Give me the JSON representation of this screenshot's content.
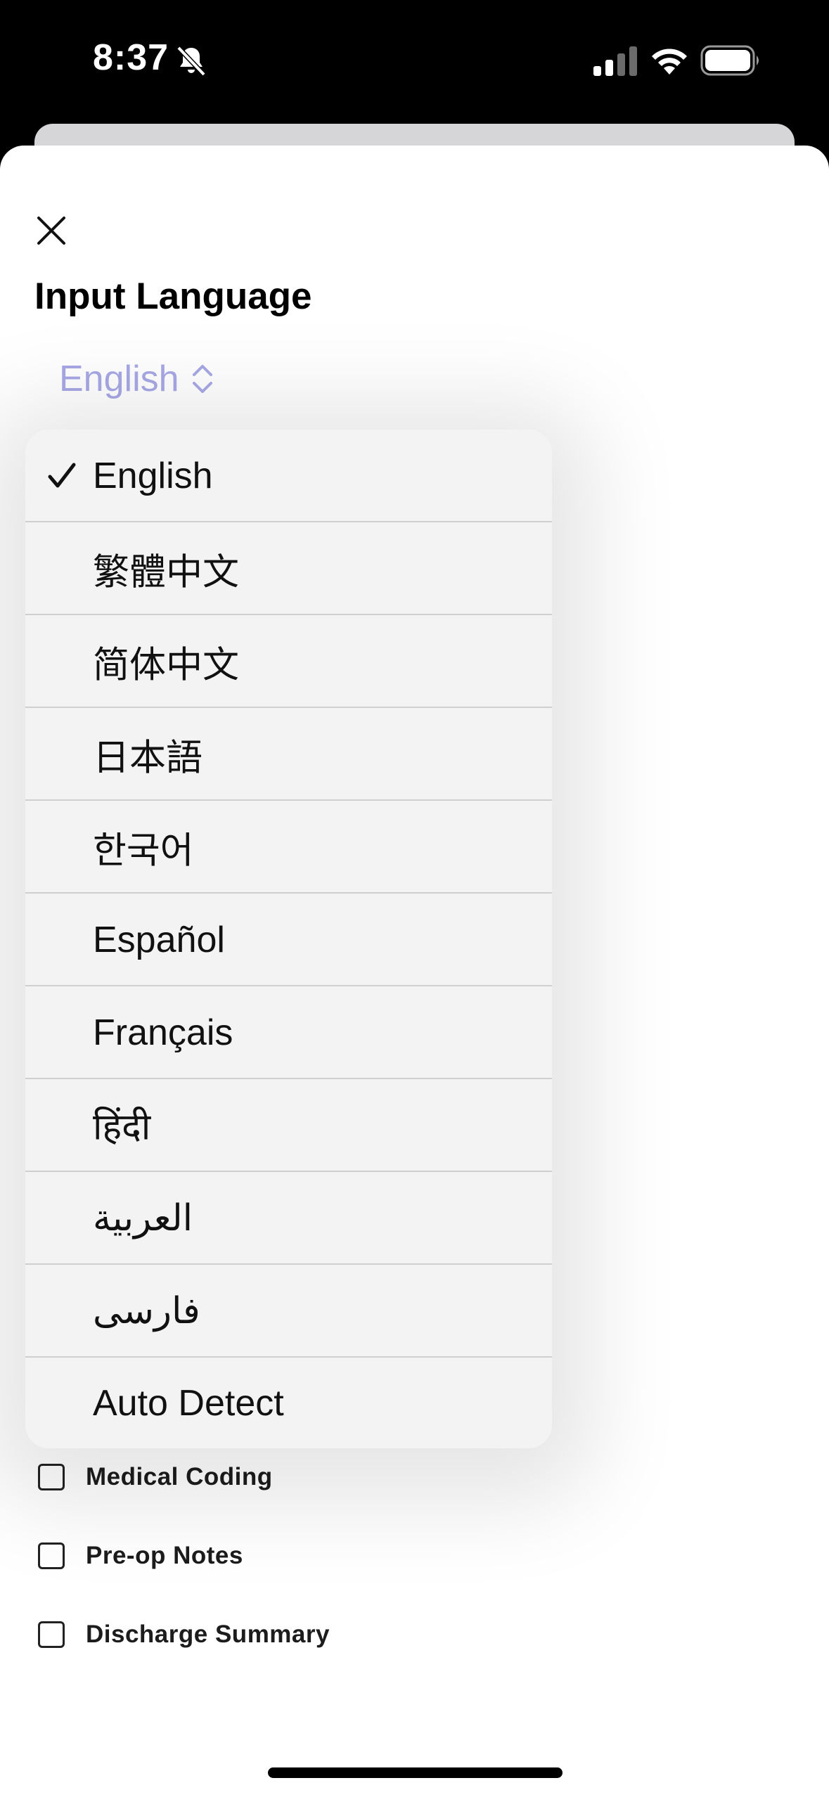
{
  "status_bar": {
    "time": "8:37",
    "icons": [
      "bell-slash-icon",
      "cellular-signal-icon",
      "wifi-icon",
      "battery-icon"
    ]
  },
  "sheet": {
    "close_icon": "close-icon",
    "title": "Input Language",
    "selected_language": "English"
  },
  "language_menu": {
    "items": [
      {
        "label": "English",
        "selected": true
      },
      {
        "label": "繁體中文",
        "selected": false
      },
      {
        "label": "简体中文",
        "selected": false
      },
      {
        "label": "日本語",
        "selected": false
      },
      {
        "label": "한국어",
        "selected": false
      },
      {
        "label": "Español",
        "selected": false
      },
      {
        "label": "Français",
        "selected": false
      },
      {
        "label": "हिंदी",
        "selected": false
      },
      {
        "label": "العربية",
        "selected": false
      },
      {
        "label": "فارسی",
        "selected": false
      },
      {
        "label": "Auto Detect",
        "selected": false
      }
    ]
  },
  "options": [
    {
      "label": "Medical Coding",
      "checked": false
    },
    {
      "label": "Pre-op Notes",
      "checked": false
    },
    {
      "label": "Discharge Summary",
      "checked": false
    }
  ],
  "colors": {
    "accent": "#a8a8e6",
    "menu_background": "#f3f3f4"
  }
}
